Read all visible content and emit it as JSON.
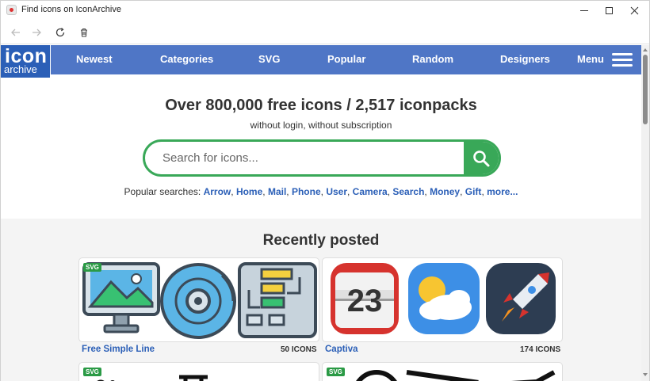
{
  "window": {
    "title": "Find icons on IconArchive"
  },
  "site": {
    "logo_top": "icon",
    "logo_bottom": "archive",
    "nav": [
      "Newest",
      "Categories",
      "SVG",
      "Popular",
      "Random",
      "Designers"
    ],
    "menu_label": "Menu"
  },
  "hero": {
    "title": "Over 800,000 free icons / 2,517 iconpacks",
    "subtitle": "without login, without subscription",
    "search_placeholder": "Search for icons...",
    "popular_label": "Popular searches:",
    "popular_terms": [
      "Arrow",
      "Home",
      "Mail",
      "Phone",
      "User",
      "Camera",
      "Search",
      "Money",
      "Gift"
    ],
    "popular_more": "more..."
  },
  "recent": {
    "title": "Recently posted",
    "packs": [
      {
        "name": "Free Simple Line",
        "count": "50 ICONS",
        "badge": "SVG"
      },
      {
        "name": "Captiva",
        "count": "174 ICONS",
        "badge": ""
      },
      {
        "name": "",
        "count": "",
        "badge": "SVG"
      },
      {
        "name": "",
        "count": "",
        "badge": "SVG"
      }
    ],
    "calendar_day": "23"
  },
  "colors": {
    "nav": "#4f76c6",
    "logo": "#2b5fb7",
    "accent_green": "#39a858",
    "link_blue": "#2b5fb7"
  }
}
